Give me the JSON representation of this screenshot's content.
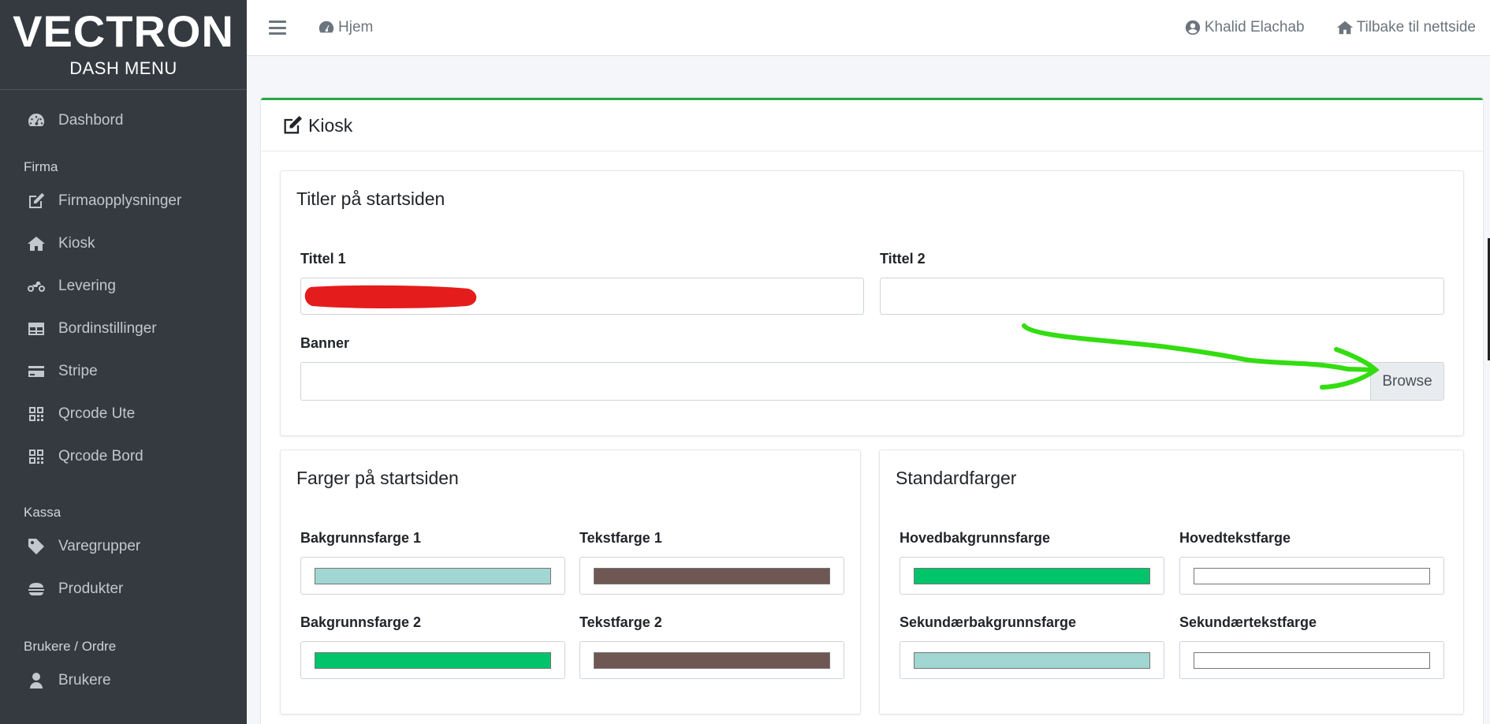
{
  "brand": {
    "title": "VECTRON",
    "subtitle": "DASH MENU"
  },
  "sidebar": {
    "dashboard": "Dashbord",
    "sections": [
      {
        "header": "Firma",
        "items": [
          {
            "label": "Firmaopplysninger",
            "icon": "edit-icon"
          },
          {
            "label": "Kiosk",
            "icon": "home-icon"
          },
          {
            "label": "Levering",
            "icon": "motorcycle-icon"
          },
          {
            "label": "Bordinstillinger",
            "icon": "table-icon"
          },
          {
            "label": "Stripe",
            "icon": "credit-card-icon"
          },
          {
            "label": "Qrcode Ute",
            "icon": "qrcode-icon"
          },
          {
            "label": "Qrcode Bord",
            "icon": "qrcode-icon"
          }
        ]
      },
      {
        "header": "Kassa",
        "items": [
          {
            "label": "Varegrupper",
            "icon": "tag-icon"
          },
          {
            "label": "Produkter",
            "icon": "hamburger-food-icon"
          }
        ]
      },
      {
        "header": "Brukere / Ordre",
        "items": [
          {
            "label": "Brukere",
            "icon": "user-icon"
          }
        ]
      }
    ]
  },
  "topbar": {
    "home": "Hjem",
    "user": "Khalid Elachab",
    "back": "Tilbake til nettside"
  },
  "card": {
    "title": "Kiosk"
  },
  "titles_panel": {
    "title": "Titler på startsiden",
    "tittel1_label": "Tittel 1",
    "tittel2_label": "Tittel 2",
    "banner_label": "Banner",
    "browse": "Browse"
  },
  "colors_panel": {
    "title": "Farger på startsiden",
    "bg1_label": "Bakgrunnsfarge 1",
    "text1_label": "Tekstfarge 1",
    "bg2_label": "Bakgrunnsfarge 2",
    "text2_label": "Tekstfarge 2",
    "bg1": "#a1d6d2",
    "text1": "#6f5854",
    "bg2": "#00c46a",
    "text2": "#6f5854"
  },
  "standard_panel": {
    "title": "Standardfarger",
    "main_bg_label": "Hovedbakgrunnsfarge",
    "main_text_label": "Hovedtekstfarge",
    "sec_bg_label": "Sekundærbakgrunnsfarge",
    "sec_text_label": "Sekundærtekstfarge",
    "main_bg": "#00c46a",
    "main_text": "#ffffff",
    "sec_bg": "#a1d6d2",
    "sec_text": "#ffffff"
  },
  "accent": {
    "card_border": "#28a745",
    "annotation_arrow": "#33dd11",
    "redaction": "#e51c1c"
  }
}
